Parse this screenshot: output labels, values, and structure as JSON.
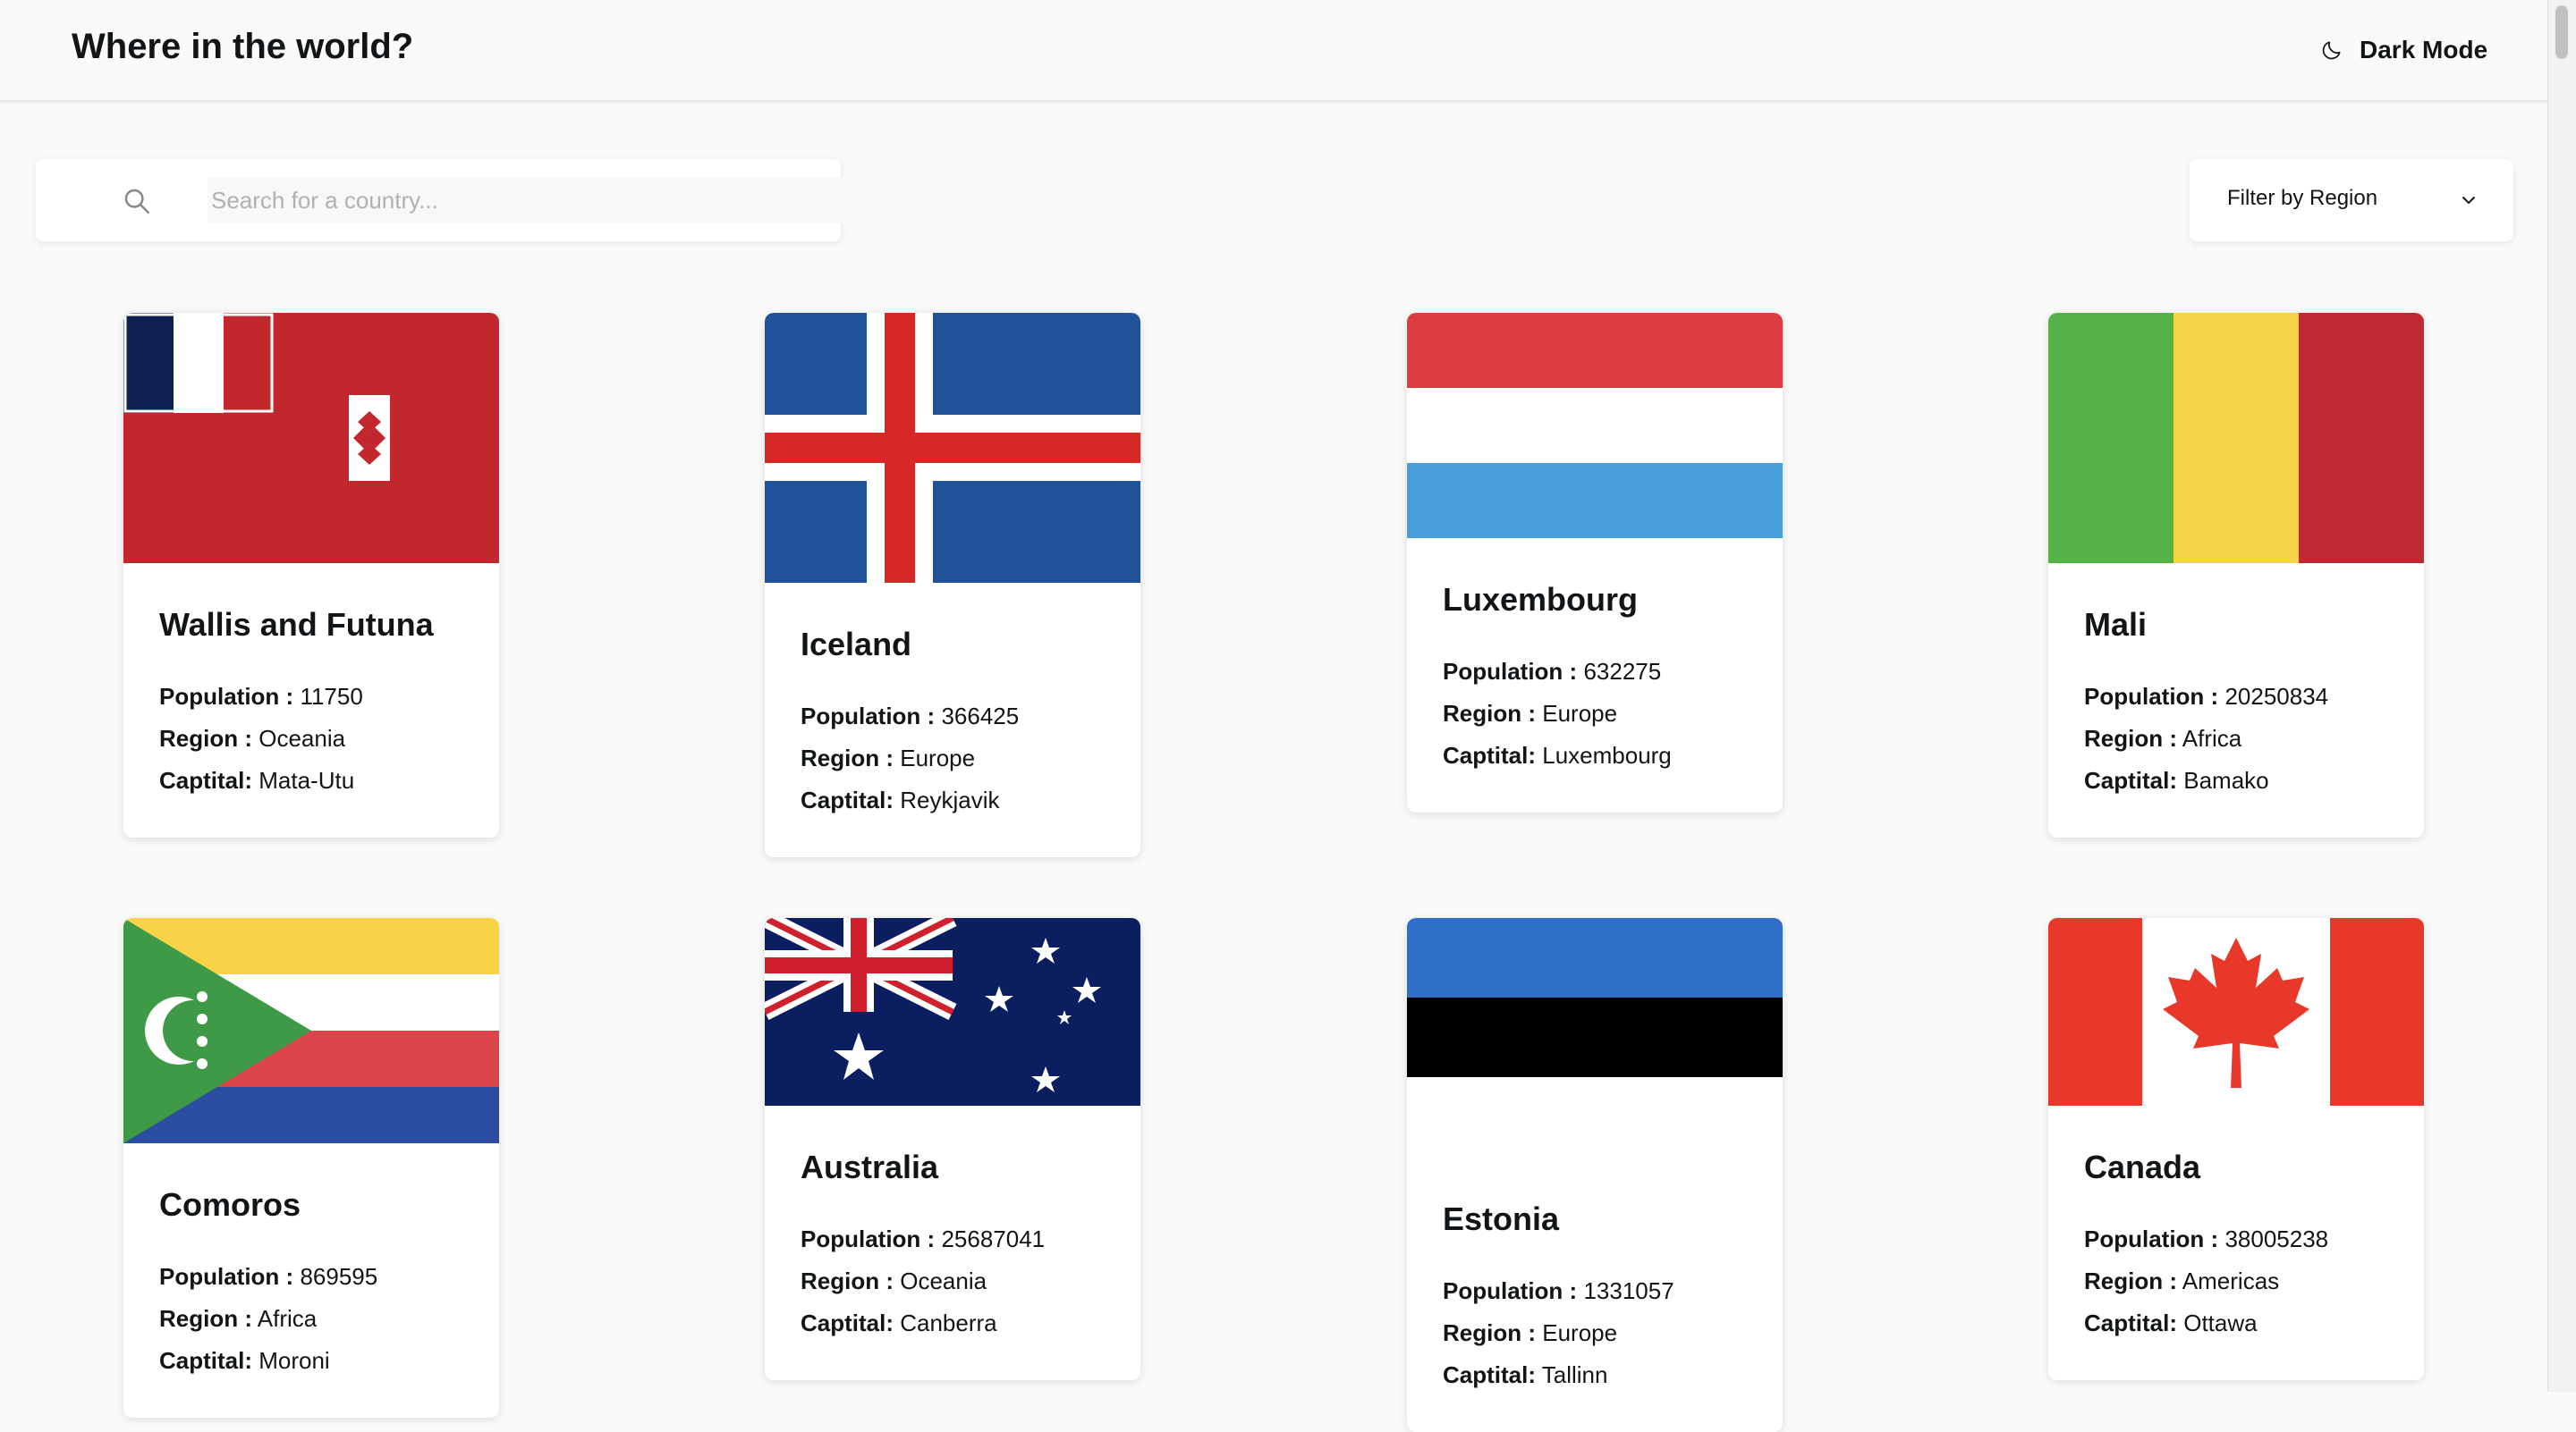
{
  "header": {
    "title": "Where in the world?",
    "dark_mode_label": "Dark Mode"
  },
  "search": {
    "placeholder": "Search for a country...",
    "value": ""
  },
  "filter": {
    "label": "Filter by Region"
  },
  "labels": {
    "population": "Population :",
    "region": "Region :",
    "capital": "Captital:"
  },
  "countries": [
    {
      "name": "Wallis and Futuna",
      "population": "11750",
      "region": "Oceania",
      "capital": "Mata-Utu",
      "flag": "wallis-and-futuna-flag"
    },
    {
      "name": "Iceland",
      "population": "366425",
      "region": "Europe",
      "capital": "Reykjavik",
      "flag": "iceland-flag"
    },
    {
      "name": "Luxembourg",
      "population": "632275",
      "region": "Europe",
      "capital": "Luxembourg",
      "flag": "luxembourg-flag"
    },
    {
      "name": "Mali",
      "population": "20250834",
      "region": "Africa",
      "capital": "Bamako",
      "flag": "mali-flag"
    },
    {
      "name": "Comoros",
      "population": "869595",
      "region": "Africa",
      "capital": "Moroni",
      "flag": "comoros-flag"
    },
    {
      "name": "Australia",
      "population": "25687041",
      "region": "Oceania",
      "capital": "Canberra",
      "flag": "australia-flag"
    },
    {
      "name": "Estonia",
      "population": "1331057",
      "region": "Europe",
      "capital": "Tallinn",
      "flag": "estonia-flag"
    },
    {
      "name": "Canada",
      "population": "38005238",
      "region": "Americas",
      "capital": "Ottawa",
      "flag": "canada-flag"
    }
  ],
  "colors": {
    "background": "#fafafa",
    "card": "#ffffff",
    "text": "#111517"
  }
}
